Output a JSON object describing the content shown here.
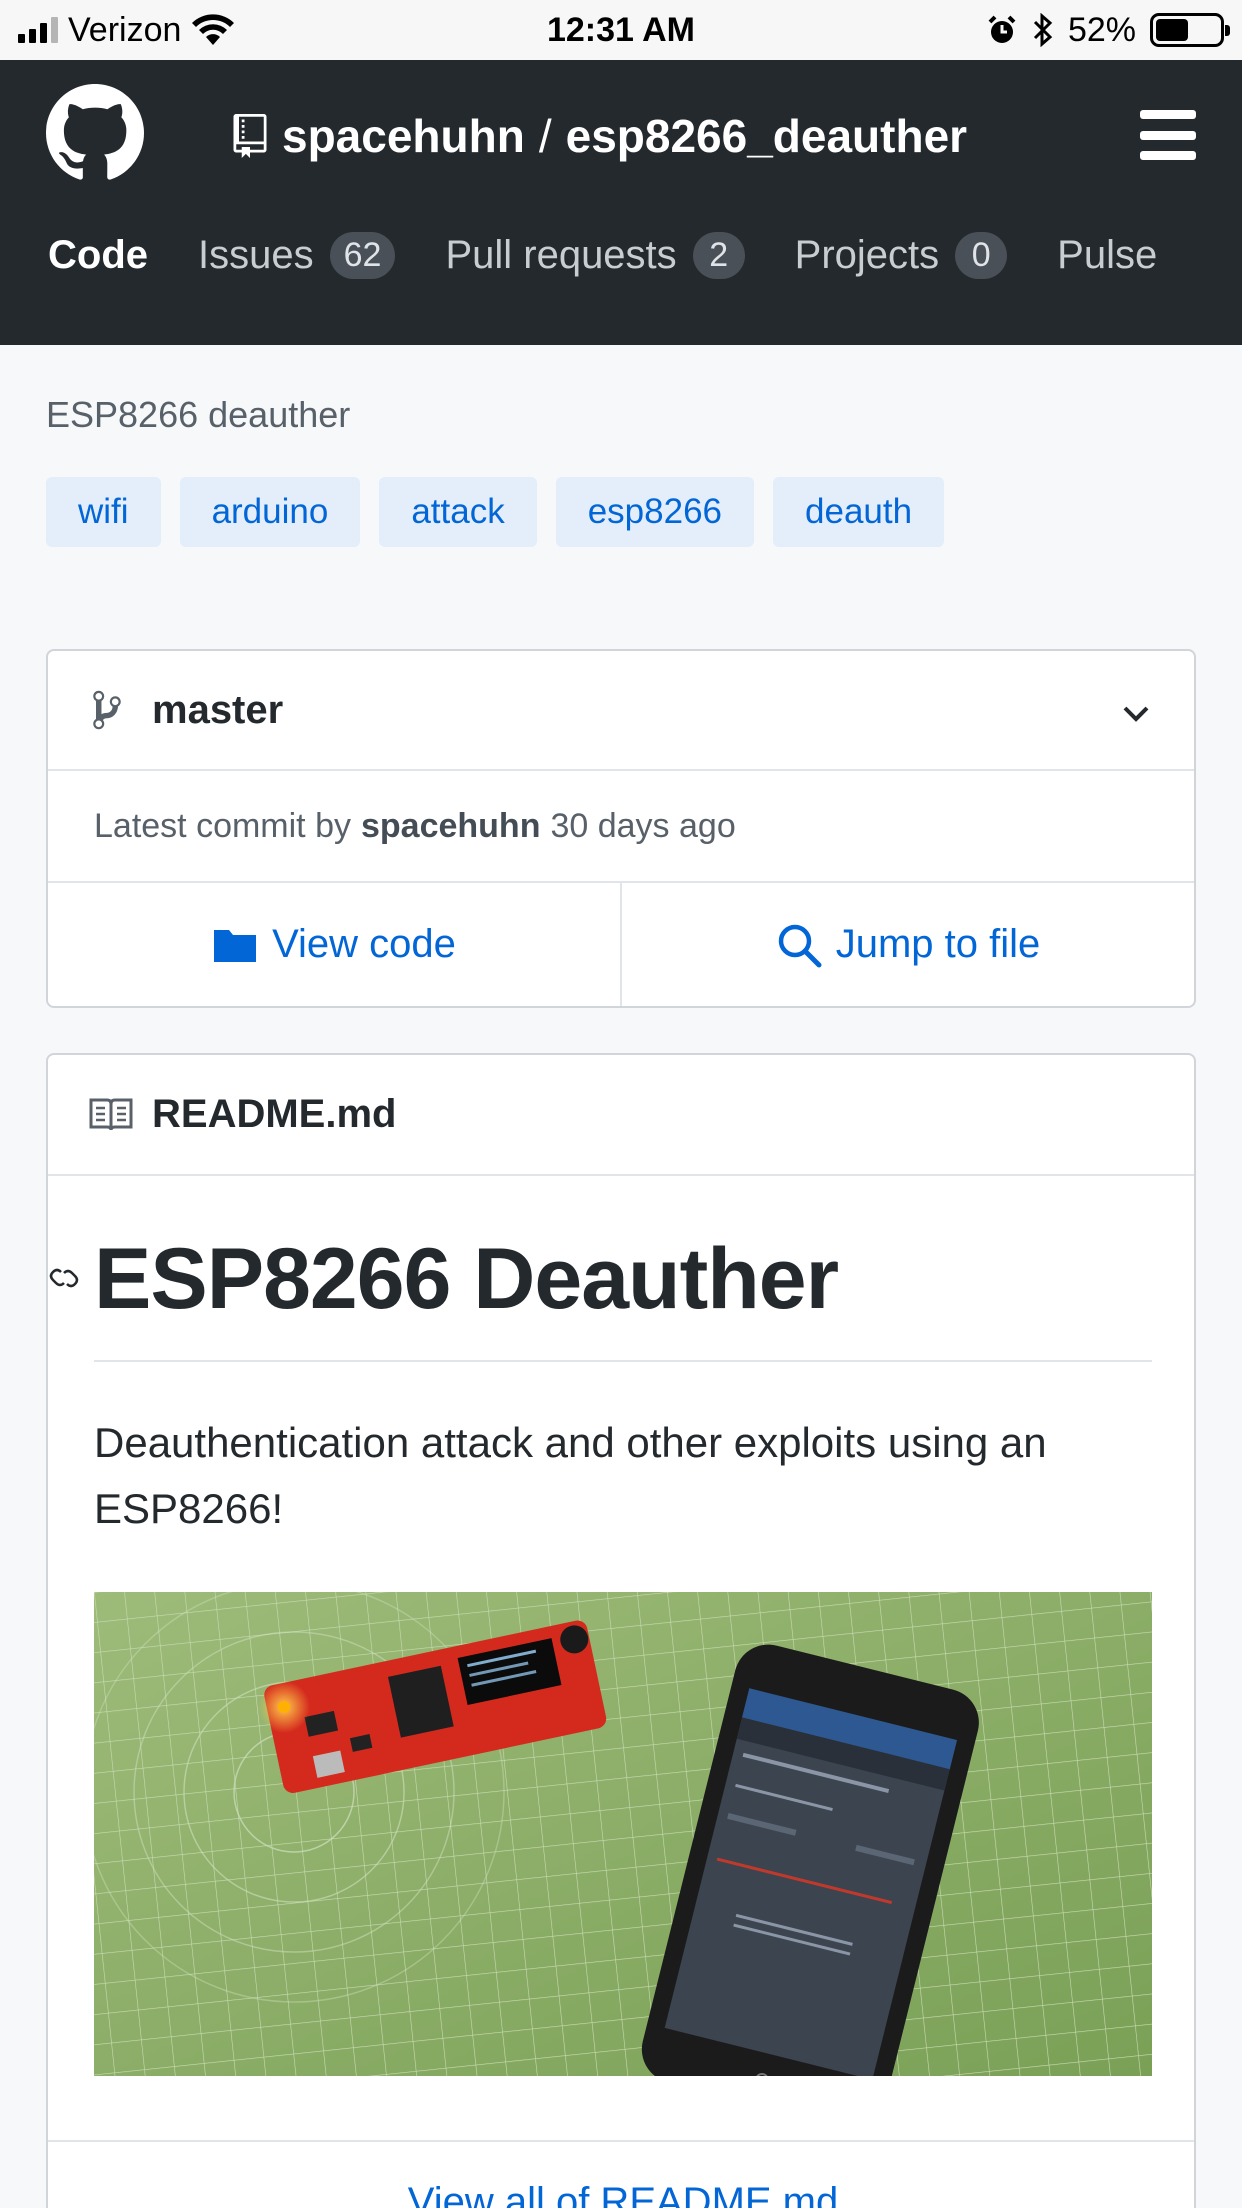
{
  "status_bar": {
    "carrier": "Verizon",
    "time": "12:31 AM",
    "battery": "52%",
    "battery_level": 0.52
  },
  "header": {
    "owner": "spacehuhn",
    "separator": "/",
    "repo": "esp8266_deauther",
    "nav": [
      {
        "label": "Code",
        "count": ""
      },
      {
        "label": "Issues",
        "count": "62"
      },
      {
        "label": "Pull requests",
        "count": "2"
      },
      {
        "label": "Projects",
        "count": "0"
      },
      {
        "label": "Pulse",
        "count": ""
      }
    ]
  },
  "repo": {
    "description": "ESP8266 deauther",
    "topics": [
      "wifi",
      "arduino",
      "attack",
      "esp8266",
      "deauth"
    ]
  },
  "branch_box": {
    "branch": "master",
    "commit_prefix": "Latest commit by",
    "commit_author": "spacehuhn",
    "commit_time": "30 days ago",
    "view_code": "View code",
    "jump_to_file": "Jump to file"
  },
  "readme": {
    "filename": "README.md",
    "title": "ESP8266 Deauther",
    "text": "Deauthentication attack and other exploits using an ESP8266!",
    "view_all": "View all of README.md"
  },
  "colors": {
    "header_bg": "#24292e",
    "link": "#0366d6",
    "topic_bg": "#e3eefa",
    "board_red": "#d42a1e",
    "mat_green": "#8fb26b"
  },
  "icons": {
    "logo": "github-octocat-icon",
    "repo": "repo-icon",
    "menu": "hamburger-menu-icon",
    "branch": "git-branch-icon",
    "chevron": "chevron-down-icon",
    "folder": "folder-icon",
    "search": "search-icon",
    "book": "book-icon",
    "anchor": "link-anchor-icon"
  }
}
